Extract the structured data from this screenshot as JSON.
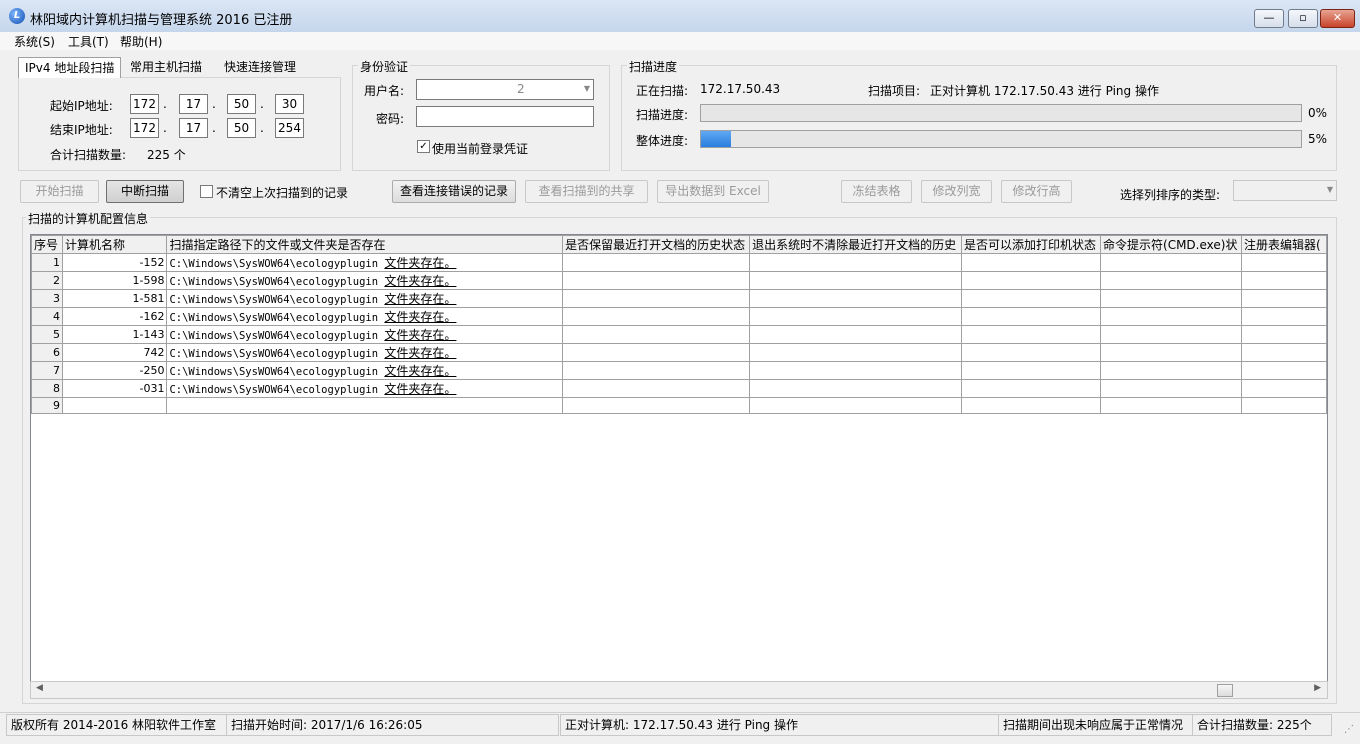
{
  "window": {
    "title": "林阳域内计算机扫描与管理系统 2016 已注册"
  },
  "menu": [
    "系统(S)",
    "工具(T)",
    "帮助(H)"
  ],
  "tabs": [
    "IPv4 地址段扫描",
    "常用主机扫描",
    "快速连接管理"
  ],
  "ip_range": {
    "start_label": "起始IP地址:",
    "start": [
      "172",
      "17",
      "50",
      "30"
    ],
    "end_label": "结束IP地址:",
    "end": [
      "172",
      "17",
      "50",
      "254"
    ],
    "total_label": "合计扫描数量:",
    "total_value": "225 个"
  },
  "auth": {
    "title": "身份验证",
    "username_label": "用户名:",
    "username_value": "2",
    "password_label": "密码:",
    "use_current_label": "使用当前登录凭证",
    "use_current_checked": true
  },
  "progress": {
    "title": "扫描进度",
    "scanning_label": "正在扫描:",
    "scanning_ip": "172.17.50.43",
    "item_label": "扫描项目:",
    "item_value": "正对计算机 172.17.50.43 进行 Ping 操作",
    "scan_progress_label": "扫描进度:",
    "scan_progress_value": 0,
    "scan_progress_text": "0%",
    "overall_label": "整体进度:",
    "overall_value": 5,
    "overall_text": "5%"
  },
  "toolbar": {
    "start": "开始扫描",
    "stop": "中断扫描",
    "no_clear_label": "不清空上次扫描到的记录",
    "view_errors": "查看连接错误的记录",
    "view_shares": "查看扫描到的共享",
    "export": "导出数据到 Excel",
    "freeze": "冻结表格",
    "col_width": "修改列宽",
    "row_height": "修改行高",
    "sort_label": "选择列排序的类型:"
  },
  "grid": {
    "title": "扫描的计算机配置信息",
    "columns": [
      "序号",
      "计算机名称",
      "扫描指定路径下的文件或文件夹是否存在",
      "是否保留最近打开文档的历史状态",
      "退出系统时不清除最近打开文档的历史",
      "是否可以添加打印机状态",
      "命令提示符(CMD.exe)状",
      "注册表编辑器("
    ],
    "path_prefix": "C:\\Windows\\SysWOW64\\ecologyplugin ",
    "path_suffix": "文件夹存在。",
    "rows": [
      {
        "no": "1",
        "name": "-152",
        "has_path": true
      },
      {
        "no": "2",
        "name": "1-598",
        "has_path": true
      },
      {
        "no": "3",
        "name": "1-581",
        "has_path": true
      },
      {
        "no": "4",
        "name": "-162",
        "has_path": true
      },
      {
        "no": "5",
        "name": "1-143",
        "has_path": true
      },
      {
        "no": "6",
        "name": "742",
        "has_path": true
      },
      {
        "no": "7",
        "name": "-250",
        "has_path": true
      },
      {
        "no": "8",
        "name": "-031",
        "has_path": true
      },
      {
        "no": "9",
        "name": "",
        "has_path": false
      }
    ]
  },
  "statusbar": {
    "copyright": "版权所有 2014-2016 林阳软件工作室",
    "start_time": "扫描开始时间: 2017/1/6 16:26:05",
    "current": "正对计算机: 172.17.50.43 进行 Ping 操作",
    "note": "扫描期间出现未响应属于正常情况",
    "total": "合计扫描数量: 225个"
  }
}
